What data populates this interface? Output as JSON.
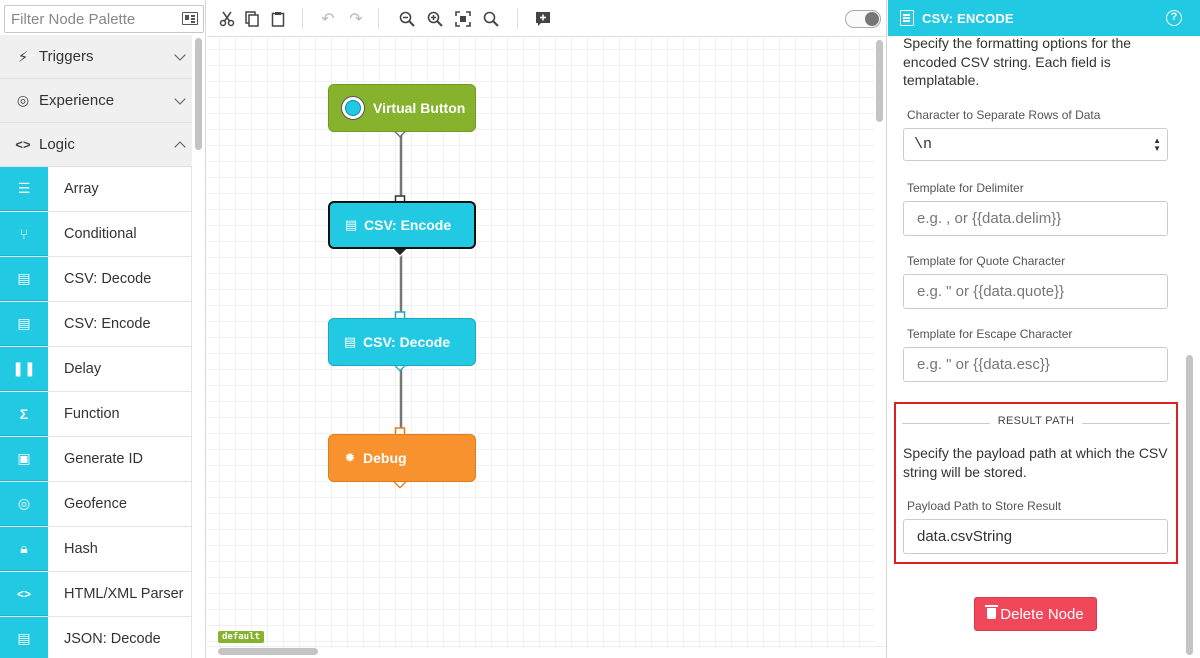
{
  "palette": {
    "filter_placeholder": "Filter Node Palette",
    "categories": [
      {
        "label": "Triggers",
        "icon": "bolt-icon"
      },
      {
        "label": "Experience",
        "icon": "experience-icon"
      },
      {
        "label": "Logic",
        "icon": "code-icon"
      }
    ],
    "items": [
      {
        "label": "Array",
        "icon": "list-icon"
      },
      {
        "label": "Conditional",
        "icon": "branch-icon"
      },
      {
        "label": "CSV: Decode",
        "icon": "document-icon"
      },
      {
        "label": "CSV: Encode",
        "icon": "document-icon"
      },
      {
        "label": "Delay",
        "icon": "pause-icon"
      },
      {
        "label": "Function",
        "icon": "sigma-icon"
      },
      {
        "label": "Generate ID",
        "icon": "id-card-icon"
      },
      {
        "label": "Geofence",
        "icon": "target-icon"
      },
      {
        "label": "Hash",
        "icon": "lock-icon"
      },
      {
        "label": "HTML/XML Parser",
        "icon": "code-icon"
      },
      {
        "label": "JSON: Decode",
        "icon": "document-icon"
      }
    ]
  },
  "toolbar": {
    "buttons": [
      "cut-icon",
      "copy-icon",
      "paste-icon",
      "undo-icon",
      "redo-icon",
      "zoom-out-icon",
      "zoom-in-icon",
      "fit-icon",
      "zoom-reset-icon",
      "add-note-icon"
    ]
  },
  "canvas": {
    "nodes": [
      {
        "label": "Virtual Button",
        "type": "trigger"
      },
      {
        "label": "CSV: Encode",
        "type": "logic"
      },
      {
        "label": "CSV: Decode",
        "type": "logic"
      },
      {
        "label": "Debug",
        "type": "output"
      }
    ],
    "branch_label": "default"
  },
  "panel": {
    "title": "CSV: ENCODE",
    "description": "Specify the formatting options for the encoded CSV string. Each field is templatable.",
    "row_separator_label": "Character to Separate Rows of Data",
    "row_separator_value": "\\n",
    "delimiter_label": "Template for Delimiter",
    "delimiter_placeholder": "e.g. , or {{data.delim}}",
    "quote_label": "Template for Quote Character",
    "quote_placeholder": "e.g. \" or {{data.quote}}",
    "escape_label": "Template for Escape Character",
    "escape_placeholder": "e.g. \" or {{data.esc}}",
    "result_path_title": "RESULT PATH",
    "result_path_description": "Specify the payload path at which the CSV string will be stored.",
    "result_path_label": "Payload Path to Store Result",
    "result_path_value": "data.csvString",
    "delete_label": "Delete Node"
  },
  "colors": {
    "accent": "#22c9e3",
    "trigger": "#86b22e",
    "output": "#f7922f",
    "danger": "#f0485a",
    "highlight": "#e02020"
  }
}
